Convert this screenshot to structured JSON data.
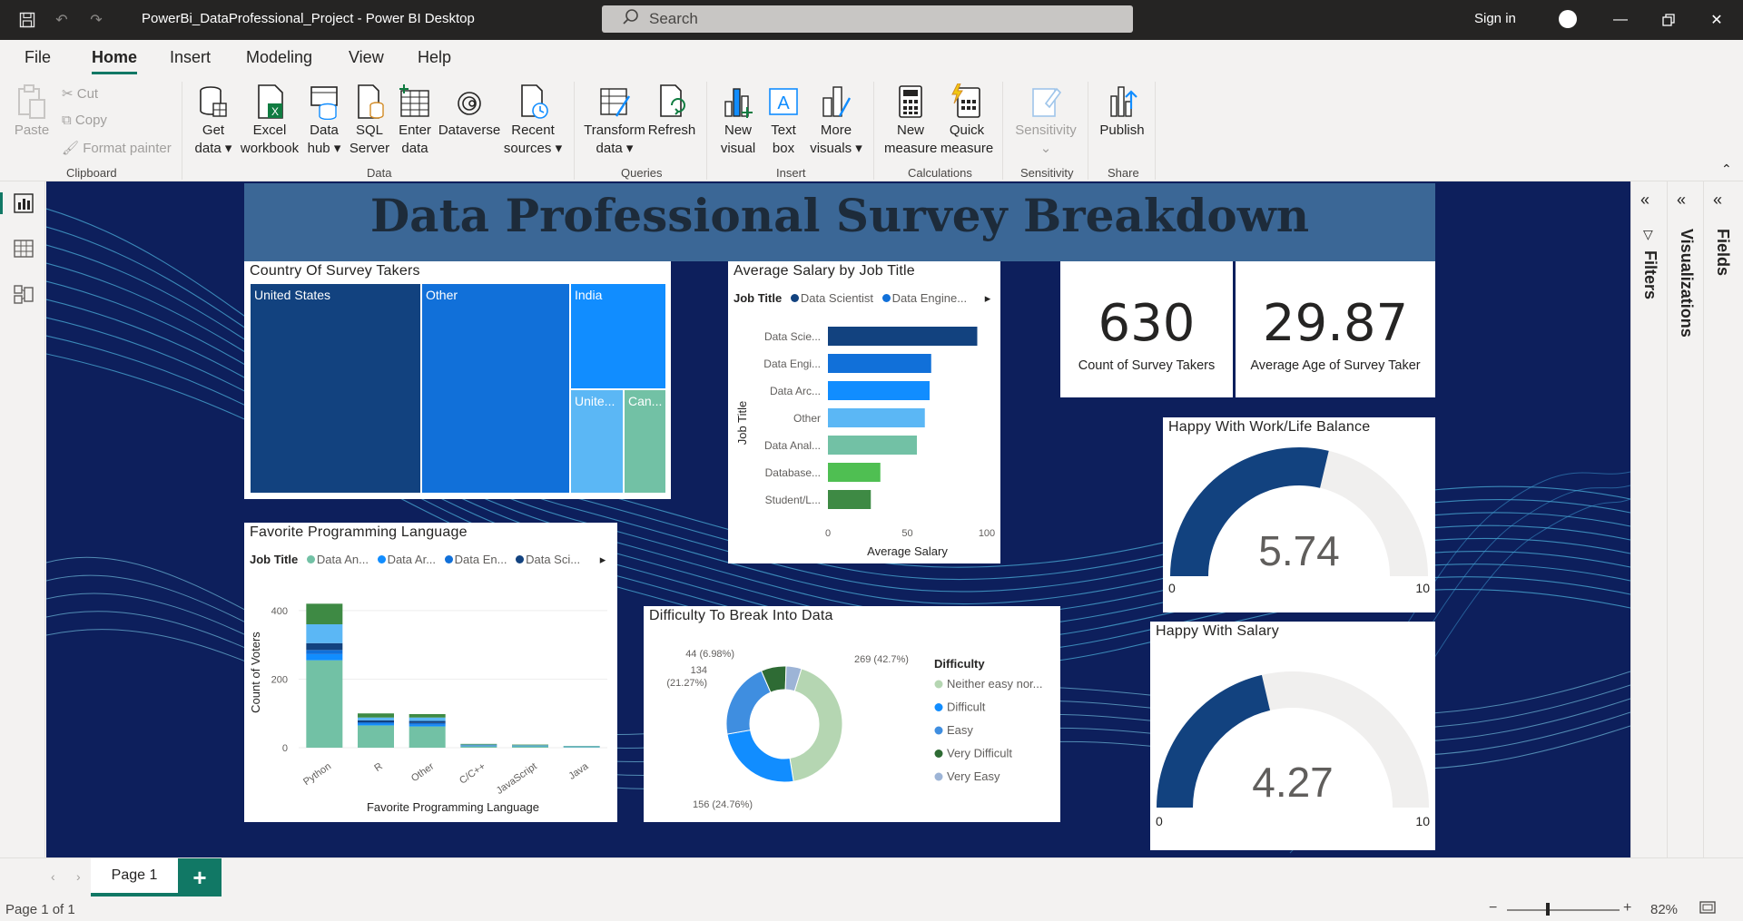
{
  "window": {
    "title": "PowerBi_DataProfessional_Project - Power BI Desktop",
    "search_placeholder": "Search",
    "sign_in": "Sign in"
  },
  "menu": {
    "tabs": [
      "File",
      "Home",
      "Insert",
      "Modeling",
      "View",
      "Help"
    ],
    "active": "Home"
  },
  "ribbon": {
    "clipboard": {
      "paste": "Paste",
      "cut": "Cut",
      "copy": "Copy",
      "format_painter": "Format painter",
      "label": "Clipboard"
    },
    "data": {
      "get_data": [
        "Get",
        "data"
      ],
      "excel": [
        "Excel",
        "workbook"
      ],
      "data_hub": [
        "Data",
        "hub"
      ],
      "sql": [
        "SQL",
        "Server"
      ],
      "enter_data": [
        "Enter",
        "data"
      ],
      "dataverse": "Dataverse",
      "recent": [
        "Recent",
        "sources"
      ],
      "label": "Data"
    },
    "queries": {
      "transform": [
        "Transform",
        "data"
      ],
      "refresh": "Refresh",
      "label": "Queries"
    },
    "insert": {
      "new_visual": [
        "New",
        "visual"
      ],
      "text_box": [
        "Text",
        "box"
      ],
      "more_visuals": [
        "More",
        "visuals"
      ],
      "label": "Insert"
    },
    "calculations": {
      "new_measure": [
        "New",
        "measure"
      ],
      "quick_measure": [
        "Quick",
        "measure"
      ],
      "label": "Calculations"
    },
    "sensitivity": {
      "button": "Sensitivity",
      "label": "Sensitivity"
    },
    "share": {
      "publish": "Publish",
      "label": "Share"
    }
  },
  "panes": {
    "filters": "Filters",
    "visualizations": "Visualizations",
    "fields": "Fields"
  },
  "pages": {
    "tab": "Page 1",
    "status": "Page 1 of 1",
    "zoom": "82%"
  },
  "colors": {
    "canvas": "#0d1f5c",
    "accent": "#117865",
    "dark_blue": "#12427f",
    "blue": "#1170d9",
    "bright_blue": "#118dff",
    "light_blue": "#5bb7f5",
    "teal": "#72c1a5",
    "green": "#4fbf52",
    "dark_green": "#3e8a44"
  },
  "report": {
    "title": "Data Professional Survey Breakdown",
    "treemap": {
      "title": "Country Of Survey Takers",
      "items": [
        {
          "label": "United States",
          "color": "#12427f"
        },
        {
          "label": "Other",
          "color": "#1170d9"
        },
        {
          "label": "India",
          "color": "#118dff"
        },
        {
          "label": "Unite...",
          "color": "#5bb7f5"
        },
        {
          "label": "Can...",
          "color": "#72c1a5"
        }
      ]
    },
    "salary": {
      "title": "Average Salary by Job Title",
      "legend_title": "Job Title",
      "legend": [
        {
          "name": "Data Scientist",
          "color": "#12427f"
        },
        {
          "name": "Data Engine...",
          "color": "#1170d9"
        }
      ]
    },
    "cards": [
      {
        "value": "630",
        "label": "Count of Survey Takers"
      },
      {
        "value": "29.87",
        "label": "Average Age of Survey Taker"
      }
    ],
    "gauge_worklife": {
      "title": "Happy With Work/Life Balance",
      "value": "5.74",
      "min": "0",
      "max": "10",
      "fraction": 0.574
    },
    "gauge_salary": {
      "title": "Happy With Salary",
      "value": "4.27",
      "min": "0",
      "max": "10",
      "fraction": 0.427
    },
    "language": {
      "title": "Favorite Programming Language",
      "legend_title": "Job Title",
      "legend": [
        {
          "name": "Data An...",
          "color": "#72c1a5"
        },
        {
          "name": "Data Ar...",
          "color": "#118dff"
        },
        {
          "name": "Data En...",
          "color": "#1170d9"
        },
        {
          "name": "Data Sci...",
          "color": "#12427f"
        }
      ]
    },
    "difficulty": {
      "title": "Difficulty To Break Into Data",
      "legend_title": "Difficulty"
    }
  },
  "chart_data": [
    {
      "type": "bar",
      "title": "Average Salary by Job Title",
      "orientation": "horizontal",
      "categories": [
        "Data Scie...",
        "Data Engi...",
        "Data Arc...",
        "Other",
        "Data Anal...",
        "Database...",
        "Student/L..."
      ],
      "values": [
        94,
        65,
        64,
        61,
        56,
        33,
        27
      ],
      "colors": [
        "#12427f",
        "#1170d9",
        "#118dff",
        "#5bb7f5",
        "#72c1a5",
        "#4fbf52",
        "#3e8a44"
      ],
      "xlabel": "Average Salary",
      "ylabel": "Job Title",
      "xlim": [
        0,
        100
      ],
      "xticks": [
        "0",
        "50",
        "100"
      ]
    },
    {
      "type": "bar",
      "title": "Favorite Programming Language",
      "stacked": true,
      "categories": [
        "Python",
        "R",
        "Other",
        "C/C++",
        "JavaScript",
        "Java"
      ],
      "series": [
        {
          "name": "Data An...",
          "color": "#72c1a5",
          "values": [
            255,
            65,
            62,
            4,
            4,
            2
          ]
        },
        {
          "name": "Data Ar...",
          "color": "#118dff",
          "values": [
            18,
            5,
            5,
            1,
            1,
            1
          ]
        },
        {
          "name": "Data En...",
          "color": "#1170d9",
          "values": [
            12,
            4,
            5,
            1,
            1,
            0
          ]
        },
        {
          "name": "Data Sci...",
          "color": "#12427f",
          "values": [
            20,
            6,
            6,
            1,
            0,
            0
          ]
        },
        {
          "color": "#5bb7f5",
          "values": [
            55,
            8,
            10,
            2,
            1,
            1
          ]
        },
        {
          "color": "#3e8a44",
          "values": [
            60,
            12,
            10,
            2,
            2,
            1
          ]
        }
      ],
      "xlabel": "Favorite Programming Language",
      "ylabel": "Count of Voters",
      "ylim": [
        0,
        450
      ],
      "yticks": [
        "0",
        "200",
        "400"
      ]
    },
    {
      "type": "pie",
      "title": "Difficulty To Break Into Data",
      "donut": true,
      "slices": [
        {
          "name": "Neither easy nor...",
          "value": 269,
          "label": "269 (42.7%)",
          "color": "#b5d6b2"
        },
        {
          "name": "Difficult",
          "value": 156,
          "label": "156 (24.76%)",
          "color": "#118dff"
        },
        {
          "name": "Easy",
          "value": 134,
          "label": "134 (21.27%)",
          "color": "#3f8ee0"
        },
        {
          "name": "Very Difficult",
          "value": 44,
          "label": "44 (6.98%)",
          "color": "#2e6b34"
        },
        {
          "name": "Very Easy",
          "value": 27,
          "color": "#9db4d6"
        }
      ]
    }
  ]
}
